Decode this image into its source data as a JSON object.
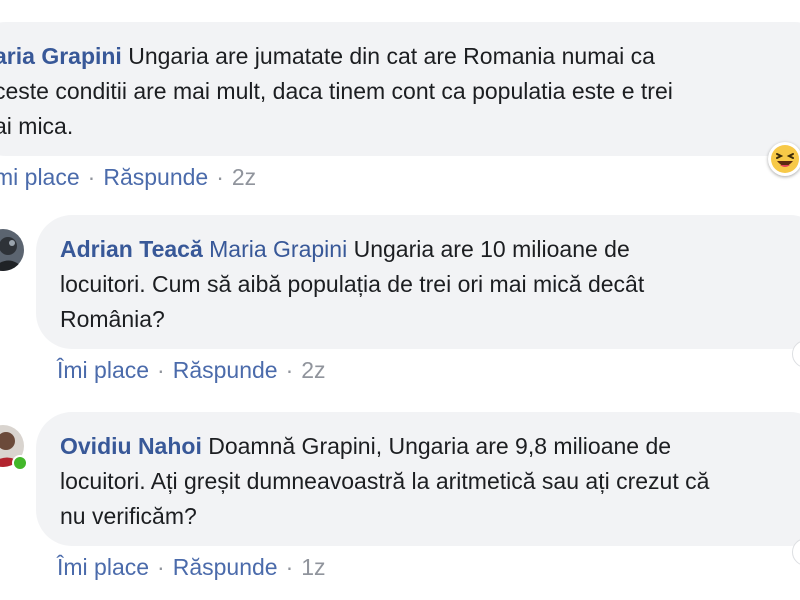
{
  "comments": [
    {
      "author": "aria Grapini",
      "lines": [
        "Ungaria are jumatate din cat are Romania numai ca",
        "ceste conditii are mai mult, daca tinem cont ca populatia este e trei",
        "ai mica."
      ],
      "actions": {
        "like": "mi place",
        "reply": "Răspunde",
        "time": "2z",
        "sep": "·"
      }
    },
    {
      "author": "Adrian Teacă",
      "mention": "Maria Grapini",
      "text_first": "Ungaria are 10 milioane de",
      "lines": [
        "locuitori. Cum să aibă populația de trei ori mai mică decât",
        "România?"
      ],
      "actions": {
        "like": "Îmi place",
        "reply": "Răspunde",
        "time": "2z",
        "sep": "·"
      }
    },
    {
      "author": "Ovidiu Nahoi",
      "text_first": "Doamnă Grapini, Ungaria are 9,8 milioane de",
      "lines": [
        "locuitori. Ați greșit dumneavoastră la aritmetică sau ați crezut că",
        "nu verificăm?"
      ],
      "actions": {
        "like": "Îmi place",
        "reply": "Răspunde",
        "time": "1z",
        "sep": "·"
      }
    }
  ],
  "colors": {
    "author": "#385898",
    "bubble": "#f2f3f5",
    "link": "#4b6bab",
    "meta": "#90949c",
    "online": "#42b72a"
  },
  "icons": [
    "haha-reaction-icon",
    "avatar-adrian",
    "avatar-ovidiu"
  ]
}
